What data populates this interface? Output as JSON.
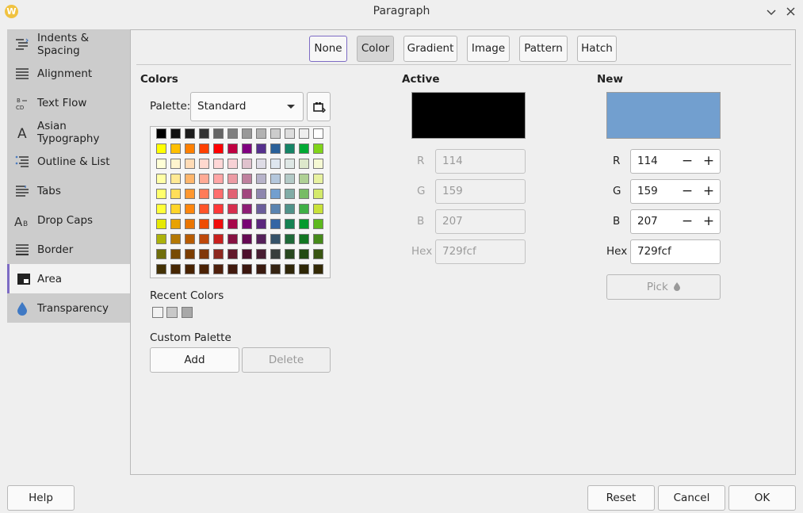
{
  "window": {
    "title": "Paragraph",
    "app_icon": "W"
  },
  "sidebar": {
    "items": [
      {
        "label": "Indents & Spacing",
        "icon": "indents-icon"
      },
      {
        "label": "Alignment",
        "icon": "alignment-icon"
      },
      {
        "label": "Text Flow",
        "icon": "text-flow-icon"
      },
      {
        "label": "Asian Typography",
        "icon": "asian-typography-icon"
      },
      {
        "label": "Outline & List",
        "icon": "outline-list-icon"
      },
      {
        "label": "Tabs",
        "icon": "tabs-icon"
      },
      {
        "label": "Drop Caps",
        "icon": "drop-caps-icon"
      },
      {
        "label": "Border",
        "icon": "border-icon"
      },
      {
        "label": "Area",
        "icon": "area-icon",
        "active": true
      },
      {
        "label": "Transparency",
        "icon": "transparency-icon"
      }
    ]
  },
  "area_tabs": {
    "none": "None",
    "color": "Color",
    "gradient": "Gradient",
    "image": "Image",
    "pattern": "Pattern",
    "hatch": "Hatch",
    "selected": "Color"
  },
  "colors": {
    "heading": "Colors",
    "palette_label": "Palette:",
    "palette_value": "Standard",
    "recent_label": "Recent Colors",
    "recent": [
      "#f2f2f2",
      "#c8c8c8",
      "#a8a8a8"
    ],
    "custom_palette_label": "Custom Palette",
    "add_label": "Add",
    "delete_label": "Delete",
    "palette_rows": [
      [
        "#000000",
        "#111111",
        "#1c1c1c",
        "#333333",
        "#666666",
        "#808080",
        "#999999",
        "#b2b2b2",
        "#cccccc",
        "#dddddd",
        "#eeeeee",
        "#ffffff"
      ],
      [
        "#ffff00",
        "#ffbf00",
        "#ff8000",
        "#ff4000",
        "#ff0000",
        "#bf0041",
        "#800080",
        "#55308d",
        "#2a6099",
        "#158466",
        "#00a933",
        "#81d41a"
      ],
      [
        "#ffffd7",
        "#fff5ce",
        "#ffdbb6",
        "#ffd8ce",
        "#ffd7d7",
        "#f7d1d5",
        "#e0c2cd",
        "#dedce6",
        "#dee6ef",
        "#dee7e5",
        "#dde8cb",
        "#f6f9d4"
      ],
      [
        "#ffffa6",
        "#ffe994",
        "#ffb66c",
        "#ffaa95",
        "#ffa6a6",
        "#ec9ba4",
        "#bf819e",
        "#b7b3ca",
        "#b4c7dc",
        "#b3cac7",
        "#afd095",
        "#e8f2a1"
      ],
      [
        "#ffff6d",
        "#ffde59",
        "#ff972f",
        "#ff7b59",
        "#ff6d6d",
        "#e16173",
        "#a1467e",
        "#8e86ae",
        "#729fcf",
        "#81aca6",
        "#77bc65",
        "#d4ea6b"
      ],
      [
        "#ffff38",
        "#ffd428",
        "#ff860d",
        "#ff5429",
        "#ff3838",
        "#d62e4e",
        "#8d1d75",
        "#6b5e9b",
        "#5983b0",
        "#50938a",
        "#3faf46",
        "#c9e23a"
      ],
      [
        "#e6e905",
        "#e8a202",
        "#ea7500",
        "#ed4c05",
        "#f10d0c",
        "#a7074b",
        "#780373",
        "#5b277d",
        "#3465a4",
        "#168253",
        "#069a2e",
        "#5eb91e"
      ],
      [
        "#acb20c",
        "#b47804",
        "#b85c00",
        "#be480a",
        "#c9211e",
        "#861141",
        "#650953",
        "#55215b",
        "#355269",
        "#1e6a39",
        "#127622",
        "#468a1a"
      ],
      [
        "#706e0c",
        "#784b04",
        "#7b3d00",
        "#813709",
        "#8d281e",
        "#611729",
        "#4e102d",
        "#481d32",
        "#383d3c",
        "#28471f",
        "#224b12",
        "#395511"
      ],
      [
        "#443205",
        "#472702",
        "#492300",
        "#4b2204",
        "#50200c",
        "#41190d",
        "#3b160e",
        "#3a1a0f",
        "#362413",
        "#302709",
        "#2e2706",
        "#342a06"
      ]
    ]
  },
  "active": {
    "heading": "Active",
    "color": "#000000",
    "r_label": "R",
    "r": "114",
    "g_label": "G",
    "g": "159",
    "b_label": "B",
    "b": "207",
    "hex_label": "Hex",
    "hex": "729fcf"
  },
  "new": {
    "heading": "New",
    "color": "#729fcf",
    "r_label": "R",
    "r": "114",
    "g_label": "G",
    "g": "159",
    "b_label": "B",
    "b": "207",
    "hex_label": "Hex",
    "hex": "729fcf",
    "pick_label": "Pick"
  },
  "footer": {
    "help": "Help",
    "reset": "Reset",
    "cancel": "Cancel",
    "ok": "OK"
  }
}
